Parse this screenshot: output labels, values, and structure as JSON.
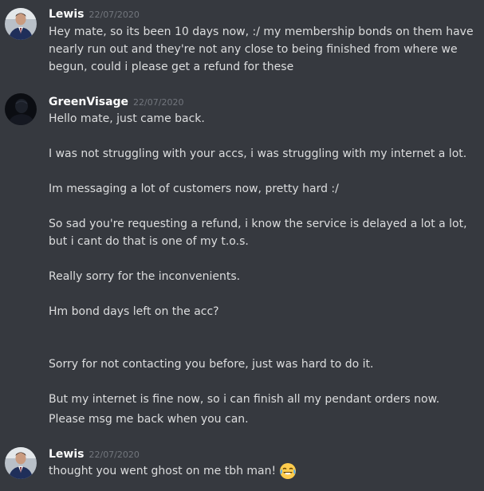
{
  "messages": [
    {
      "author": "Lewis",
      "avatar_icon": "avatar-man-in-suit-icon",
      "timestamp": "22/07/2020",
      "lines": [
        "Hey mate, so its been 10 days now, :/ my membership bonds on them have",
        "nearly run out and they're not any close to being finished from where we",
        "begun, could i please get a refund for these"
      ]
    },
    {
      "author": "GreenVisage",
      "avatar_icon": "avatar-dark-silhouette-icon",
      "timestamp": "22/07/2020",
      "lines": [
        "Hello mate, just came back.",
        "I was not struggling with your accs, i was struggling with my internet a lot.",
        "Im messaging a lot of customers now, pretty hard :/",
        "So sad you're requesting a refund, i know the service is delayed a lot a lot,",
        "but i cant do that is one of my t.o.s.",
        "Really sorry for the inconvenients.",
        "Hm bond days left on the acc?",
        "Sorry for not contacting you before, just was hard to do it.",
        "But my internet is fine now, so i can finish all my pendant orders now.",
        "Please msg me back when you can."
      ]
    },
    {
      "author": "Lewis",
      "avatar_icon": "avatar-man-in-suit-icon",
      "timestamp": "22/07/2020",
      "lines": [
        "thought you went ghost on me tbh man!"
      ],
      "emoji": "joy-tears-icon"
    }
  ],
  "colors": {
    "background": "#36393f",
    "username": "#ffffff",
    "timestamp": "#72767d",
    "text": "#dcddde"
  }
}
